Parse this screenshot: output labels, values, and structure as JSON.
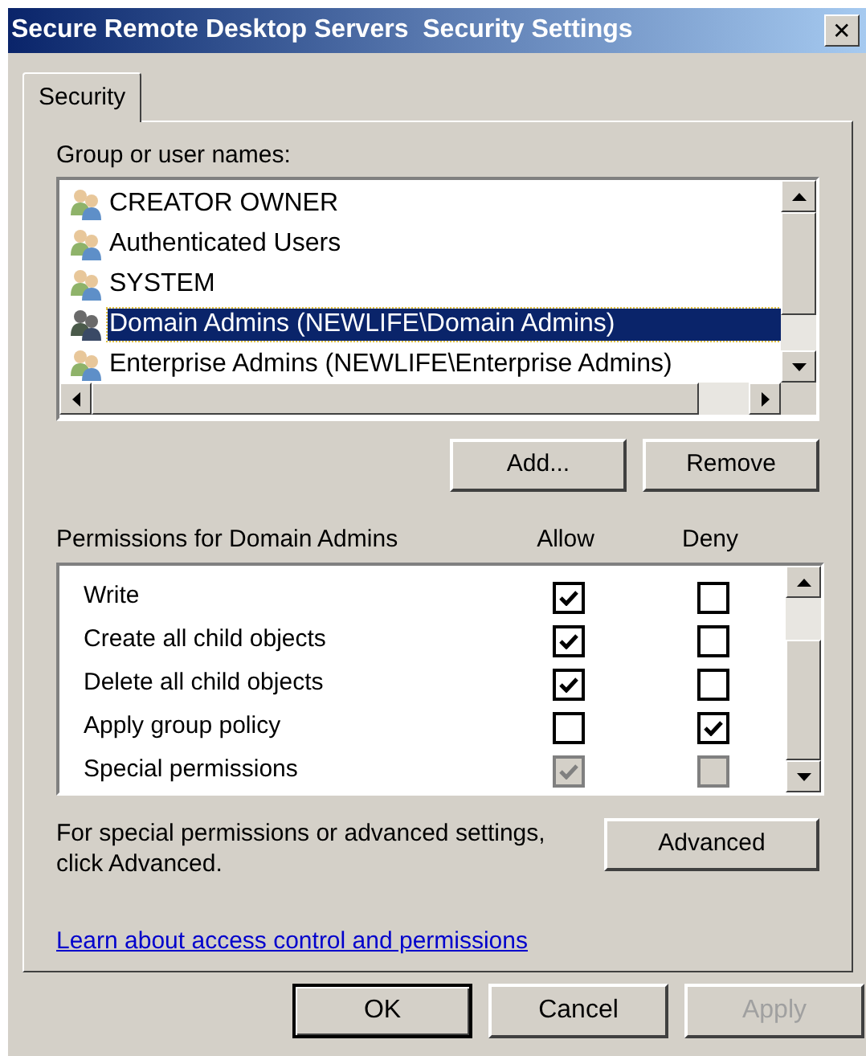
{
  "window": {
    "title": "Secure Remote Desktop Servers  Security Settings",
    "close": "✕"
  },
  "tabs": [
    {
      "label": "Security",
      "selected": true
    }
  ],
  "users": {
    "label": "Group or user names:",
    "items": [
      {
        "name": "CREATOR OWNER",
        "selected": false
      },
      {
        "name": "Authenticated Users",
        "selected": false
      },
      {
        "name": "SYSTEM",
        "selected": false
      },
      {
        "name": "Domain Admins (NEWLIFE\\Domain Admins)",
        "selected": true
      },
      {
        "name": "Enterprise Admins (NEWLIFE\\Enterprise Admins)",
        "selected": false
      }
    ]
  },
  "user_buttons": [
    "Add...",
    "Remove"
  ],
  "permissions": {
    "label": "Permissions for Domain Admins",
    "allow_header": "Allow",
    "deny_header": "Deny",
    "rows": [
      {
        "name": "Write",
        "allow": true,
        "deny": false,
        "disabled": false
      },
      {
        "name": "Create all child objects",
        "allow": true,
        "deny": false,
        "disabled": false
      },
      {
        "name": "Delete all child objects",
        "allow": true,
        "deny": false,
        "disabled": false
      },
      {
        "name": "Apply group policy",
        "allow": false,
        "deny": true,
        "disabled": false
      },
      {
        "name": "Special permissions",
        "allow": true,
        "deny": false,
        "disabled": true
      }
    ]
  },
  "advanced": {
    "text": "For special permissions or advanced settings, click Advanced.",
    "button": "Advanced"
  },
  "link": "Learn about access control and permissions",
  "footer_buttons": [
    {
      "label": "OK",
      "default": true,
      "disabled": false
    },
    {
      "label": "Cancel",
      "default": false,
      "disabled": false
    },
    {
      "label": "Apply",
      "default": false,
      "disabled": true
    }
  ]
}
